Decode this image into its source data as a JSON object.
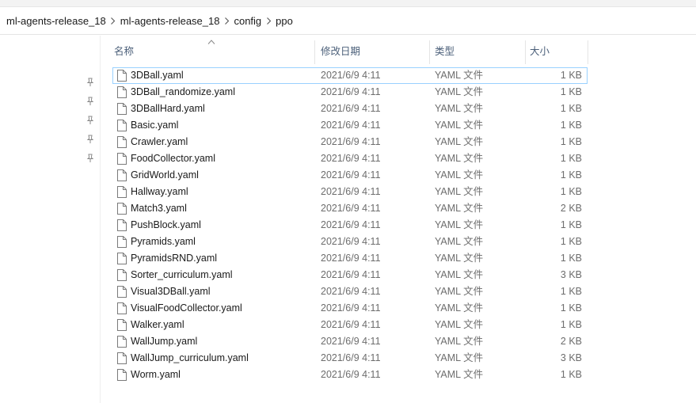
{
  "breadcrumb": [
    "ml-agents-release_18",
    "ml-agents-release_18",
    "config",
    "ppo"
  ],
  "columns": {
    "name": "名称",
    "date": "修改日期",
    "type": "类型",
    "size": "大小"
  },
  "files": [
    {
      "name": "3DBall.yaml",
      "date": "2021/6/9 4:11",
      "type": "YAML 文件",
      "size": "1 KB"
    },
    {
      "name": "3DBall_randomize.yaml",
      "date": "2021/6/9 4:11",
      "type": "YAML 文件",
      "size": "1 KB"
    },
    {
      "name": "3DBallHard.yaml",
      "date": "2021/6/9 4:11",
      "type": "YAML 文件",
      "size": "1 KB"
    },
    {
      "name": "Basic.yaml",
      "date": "2021/6/9 4:11",
      "type": "YAML 文件",
      "size": "1 KB"
    },
    {
      "name": "Crawler.yaml",
      "date": "2021/6/9 4:11",
      "type": "YAML 文件",
      "size": "1 KB"
    },
    {
      "name": "FoodCollector.yaml",
      "date": "2021/6/9 4:11",
      "type": "YAML 文件",
      "size": "1 KB"
    },
    {
      "name": "GridWorld.yaml",
      "date": "2021/6/9 4:11",
      "type": "YAML 文件",
      "size": "1 KB"
    },
    {
      "name": "Hallway.yaml",
      "date": "2021/6/9 4:11",
      "type": "YAML 文件",
      "size": "1 KB"
    },
    {
      "name": "Match3.yaml",
      "date": "2021/6/9 4:11",
      "type": "YAML 文件",
      "size": "2 KB"
    },
    {
      "name": "PushBlock.yaml",
      "date": "2021/6/9 4:11",
      "type": "YAML 文件",
      "size": "1 KB"
    },
    {
      "name": "Pyramids.yaml",
      "date": "2021/6/9 4:11",
      "type": "YAML 文件",
      "size": "1 KB"
    },
    {
      "name": "PyramidsRND.yaml",
      "date": "2021/6/9 4:11",
      "type": "YAML 文件",
      "size": "1 KB"
    },
    {
      "name": "Sorter_curriculum.yaml",
      "date": "2021/6/9 4:11",
      "type": "YAML 文件",
      "size": "3 KB"
    },
    {
      "name": "Visual3DBall.yaml",
      "date": "2021/6/9 4:11",
      "type": "YAML 文件",
      "size": "1 KB"
    },
    {
      "name": "VisualFoodCollector.yaml",
      "date": "2021/6/9 4:11",
      "type": "YAML 文件",
      "size": "1 KB"
    },
    {
      "name": "Walker.yaml",
      "date": "2021/6/9 4:11",
      "type": "YAML 文件",
      "size": "1 KB"
    },
    {
      "name": "WallJump.yaml",
      "date": "2021/6/9 4:11",
      "type": "YAML 文件",
      "size": "2 KB"
    },
    {
      "name": "WallJump_curriculum.yaml",
      "date": "2021/6/9 4:11",
      "type": "YAML 文件",
      "size": "3 KB"
    },
    {
      "name": "Worm.yaml",
      "date": "2021/6/9 4:11",
      "type": "YAML 文件",
      "size": "1 KB"
    }
  ],
  "colors": {
    "header_text": "#4c607a",
    "selection_border": "#99d1ff",
    "muted_text": "#6d6d6d"
  },
  "icons": {
    "file": "file-icon",
    "pin": "pin-icon",
    "separator": "chevron-right-icon",
    "sort": "sort-up-icon"
  }
}
